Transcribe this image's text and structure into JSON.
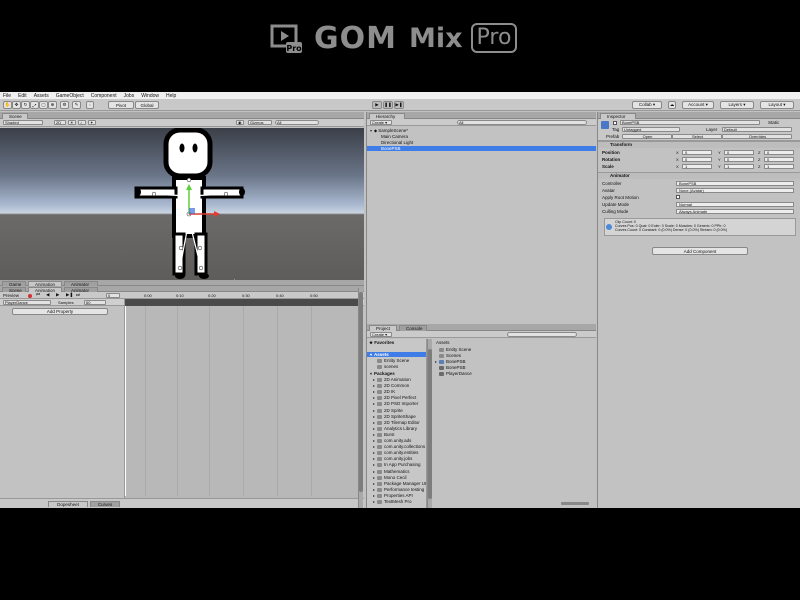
{
  "watermark": {
    "brand": "GOM",
    "product": "Mix",
    "edition": "Pro",
    "badge": "Pro"
  },
  "menubar": [
    "File",
    "Edit",
    "Assets",
    "GameObject",
    "Component",
    "Jobs",
    "Window",
    "Help"
  ],
  "toolbar": {
    "pivot": "Pivot",
    "global": "Global",
    "collab": "Collab ▾",
    "account": "Account ▾",
    "layers": "Layers ▾",
    "layout": "Layout ▾"
  },
  "scene": {
    "tab_scene": "Scene",
    "shading": "Shaded",
    "mode_2d": "2D",
    "gizmos": "Gizmos",
    "search": "All"
  },
  "hierarchy": {
    "tab": "Hierarchy",
    "create": "Create ▾",
    "search": "All",
    "scene_name": "SampleScene*",
    "items": [
      "Main Camera",
      "Directional Light",
      "BonePSB"
    ]
  },
  "inspector": {
    "tab": "Inspector",
    "object_name": "BonePSB",
    "static_label": "Static",
    "tag_label": "Tag",
    "tag_value": "Untagged",
    "layer_label": "Layer",
    "layer_value": "Default",
    "prefab_label": "Prefab",
    "open": "Open",
    "select": "Select",
    "overrides": "Overrides",
    "transform": {
      "title": "Transform",
      "rows": [
        {
          "label": "Position",
          "x": "0",
          "y": "0",
          "z": "0"
        },
        {
          "label": "Rotation",
          "x": "0",
          "y": "0",
          "z": "0"
        },
        {
          "label": "Scale",
          "x": "1",
          "y": "1",
          "z": "1"
        }
      ]
    },
    "animator": {
      "title": "Animator",
      "rows": [
        {
          "label": "Controller",
          "value": "BonePSB"
        },
        {
          "label": "Avatar",
          "value": "None (Avatar)"
        },
        {
          "label": "Apply Root Motion",
          "value": ""
        },
        {
          "label": "Update Mode",
          "value": "Normal"
        },
        {
          "label": "Culling Mode",
          "value": "Always Animate"
        }
      ],
      "info": [
        "Clip Count: 0",
        "Curves Pos: 0 Quat: 0 Euler: 0 Scale: 0 Muscles: 0 Generic: 0 PPtr: 0",
        "Curves Count: 0 Constant: 0 (0.0%) Dense: 0 (0.0%) Stream: 0 (0.0%)"
      ]
    },
    "add_component": "Add Component"
  },
  "animation": {
    "tabs": [
      "Game",
      "Animation",
      "Animator"
    ],
    "tabs_row2": [
      "Scene",
      "Animation",
      "Animator"
    ],
    "preview": "Preview",
    "clip": "PlayerDance",
    "samples_label": "Samples",
    "samples_value": "60",
    "add_property": "Add Property",
    "timeline_ticks": [
      "0:00",
      "0:10",
      "0:20",
      "0:30",
      "0:40",
      "0:50"
    ],
    "footer_tabs": [
      "Dopesheet",
      "Curves"
    ]
  },
  "project": {
    "tabs": [
      "Project",
      "Console"
    ],
    "create": "Create ▾",
    "favorites": "Favorites",
    "assets_root": "Assets",
    "assets_children": [
      "Entity Scene",
      "scenes"
    ],
    "packages_root": "Packages",
    "packages": [
      "2D Animation",
      "2D Common",
      "2D IK",
      "2D Pixel Perfect",
      "2D PSD Importer",
      "2D Sprite",
      "2D SpriteShape",
      "2D Tilemap Editor",
      "Analytics Library",
      "Burst",
      "com.unity.ads",
      "com.unity.collections",
      "com.unity.entities",
      "com.unity.jobs",
      "In App Purchasing",
      "Mathematics",
      "Mono Cecil",
      "Package Manager UI",
      "Performance testing",
      "Properties API",
      "TextMesh Pro"
    ],
    "breadcrumb": "Assets",
    "files": [
      "Entity Scene",
      "Scenes",
      "BonePSB",
      "BonePSB",
      "PlayerDance"
    ]
  },
  "colors": {
    "window_bg": "#c2c2c2",
    "selection": "#3e7de7",
    "tab_bg": "#a7a7a7",
    "sky_top": "#3a3f48",
    "ground": "#5a5957",
    "record_red": "#d23030"
  }
}
